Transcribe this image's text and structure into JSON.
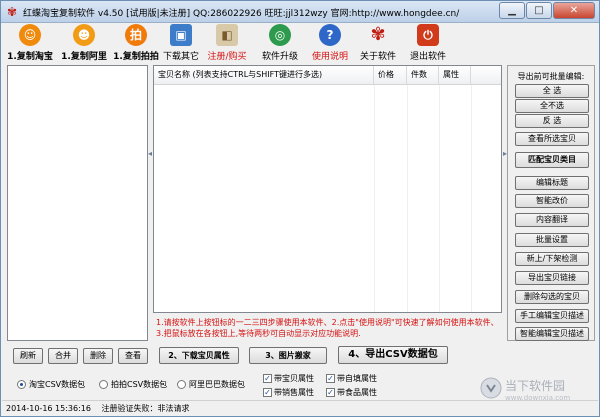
{
  "window": {
    "title": "红蝶淘宝复制软件 v4.50 [试用版|未注册] QQ:286022926 旺旺:jjl312wzy 官网:http://www.hongdee.cn/",
    "controls": {
      "minimize": "▁",
      "maximize": "□",
      "close": "✕"
    }
  },
  "toolbar": {
    "items": [
      {
        "label": "1.复制淘宝",
        "icon": "taobao-face-icon",
        "color": "#f08a0c"
      },
      {
        "label": "1.复制阿里",
        "icon": "alibaba-face-icon",
        "color": "#f29b17"
      },
      {
        "label": "1.复制拍拍",
        "icon": "paipai-icon",
        "color": "#f07a0a"
      },
      {
        "label": "下载其它",
        "icon": "computer-icon",
        "color": "#3d7cc9"
      },
      {
        "label": "注册/购买",
        "icon": "shopping-bag-icon",
        "color": "#d8c9a8"
      },
      {
        "label": "软件升级",
        "icon": "globe-icon",
        "color": "#2e9a4e"
      },
      {
        "label": "使用说明",
        "icon": "help-icon",
        "color": "#2f67c8"
      },
      {
        "label": "关于软件",
        "icon": "butterfly-icon",
        "color": "#c21c12"
      },
      {
        "label": "退出软件",
        "icon": "power-icon",
        "color": "#d23a1c"
      }
    ]
  },
  "table": {
    "columns": [
      "宝贝名称 (列表支持CTRL与SHIFT键进行多选)",
      "价格",
      "件数",
      "属性"
    ]
  },
  "note": "1.请按软件上按钮标的一二三四步骤使用本软件、2.点击\"使用说明\"可快速了解如何使用本软件、3.把鼠标放在各按钮上,等待两秒可自动显示对应功能说明.",
  "right_panel": {
    "header": "导出前可批量编辑:",
    "buttons": [
      "全 选",
      "全不选",
      "反 选",
      "查看所选宝贝",
      "匹配宝贝类目",
      "编辑标题",
      "智能改价",
      "内容翻译",
      "批量设置",
      "新上/下架检测",
      "导出宝贝链接",
      "删除勾选的宝贝",
      "手工编辑宝贝描述",
      "智能编辑宝贝描述"
    ]
  },
  "bottom": {
    "small_buttons": [
      "刷新",
      "合并",
      "删除",
      "查看"
    ],
    "download_button": "2、下载宝贝属性",
    "image_button": "3、图片搬家",
    "export_button": "4、导出CSV数据包",
    "radios": [
      "淘宝CSV数据包",
      "拍拍CSV数据包",
      "阿里巴巴数据包"
    ],
    "checks": [
      {
        "label": "带宝贝属性",
        "checked": true
      },
      {
        "label": "带销售属性",
        "checked": true
      },
      {
        "label": "带自填属性",
        "checked": true
      },
      {
        "label": "带食品属性",
        "checked": true
      }
    ]
  },
  "watermark": {
    "text": "当下软件园",
    "url": "www.downxia.com"
  },
  "status": {
    "timestamp": "2014-10-16 15:36:16",
    "message": "注册验证失败：非法请求"
  }
}
